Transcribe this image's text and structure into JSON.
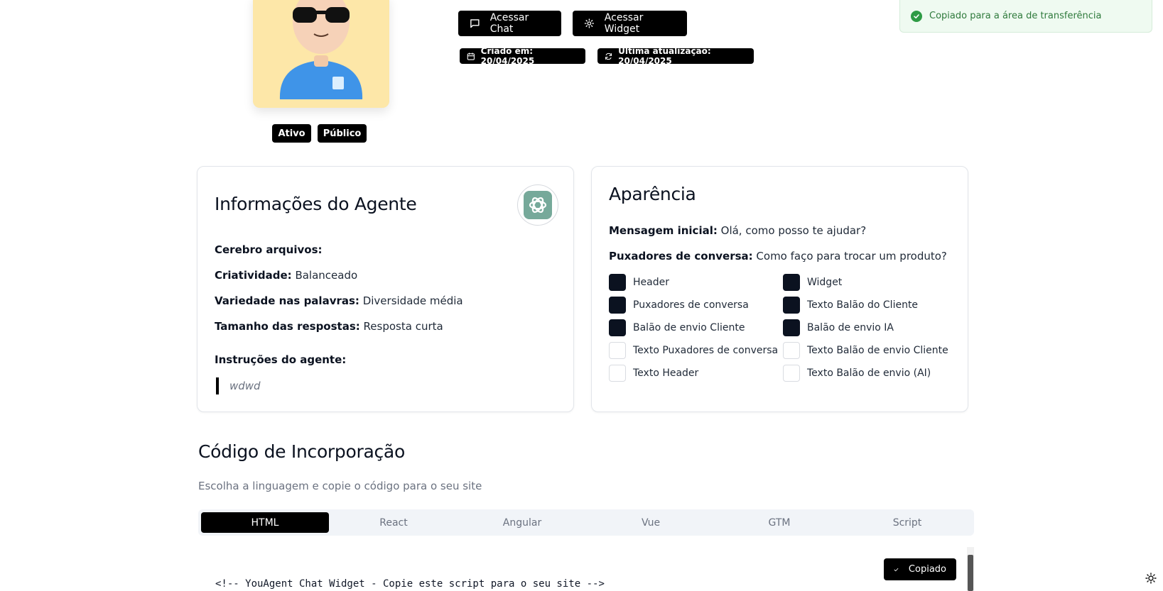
{
  "agent": {
    "status_badge": "Ativo",
    "visibility_badge": "Público"
  },
  "actions": {
    "chat_label": "Acessar Chat",
    "widget_label": "Acessar Widget"
  },
  "dates": {
    "created": "Criado em: 20/04/2025",
    "updated": "Última atualização: 20/04/2025"
  },
  "toast": {
    "message": "Copiado para a área de transferência"
  },
  "info_card": {
    "title": "Informações do Agente",
    "brain_label": "Cerebro arquivos:",
    "creativity_label": "Criatividade:",
    "creativity_value": "Balanceado",
    "variety_label": "Variedade nas palavras:",
    "variety_value": "Diversidade média",
    "length_label": "Tamanho das respostas:",
    "length_value": "Resposta curta",
    "instructions_label": "Instruções do agente:",
    "instructions_value": "wdwd"
  },
  "appearance_card": {
    "title": "Aparência",
    "initial_msg_label": "Mensagem inicial:",
    "initial_msg_value": "Olá, como posso te ajudar?",
    "pullers_label": "Puxadores de conversa:",
    "pullers_value": "Como faço para trocar um produto?",
    "colors": [
      {
        "label": "Header",
        "filled": true
      },
      {
        "label": "Widget",
        "filled": true
      },
      {
        "label": "Puxadores de conversa",
        "filled": true
      },
      {
        "label": "Texto Balão do Cliente",
        "filled": true
      },
      {
        "label": "Balão de envio Cliente",
        "filled": true
      },
      {
        "label": "Balão de envio IA",
        "filled": true
      },
      {
        "label": "Texto Puxadores de conversa",
        "filled": false
      },
      {
        "label": "Texto Balão de envio Cliente",
        "filled": false
      },
      {
        "label": "Texto Header",
        "filled": false
      },
      {
        "label": "Texto Balão de envio (AI)",
        "filled": false
      }
    ]
  },
  "embed": {
    "title": "Código de Incorporação",
    "subtitle": "Escolha a linguagem e copie o código para o seu site",
    "tabs": [
      "HTML",
      "React",
      "Angular",
      "Vue",
      "GTM",
      "Script"
    ],
    "active_tab": "HTML",
    "copied_label": "Copiado",
    "code_first_line": "<!-- YouAgent Chat Widget - Copie este script para o seu site -->"
  },
  "theme": {
    "fill_color": "#0b1220",
    "accent_success": "#2e9b45"
  }
}
